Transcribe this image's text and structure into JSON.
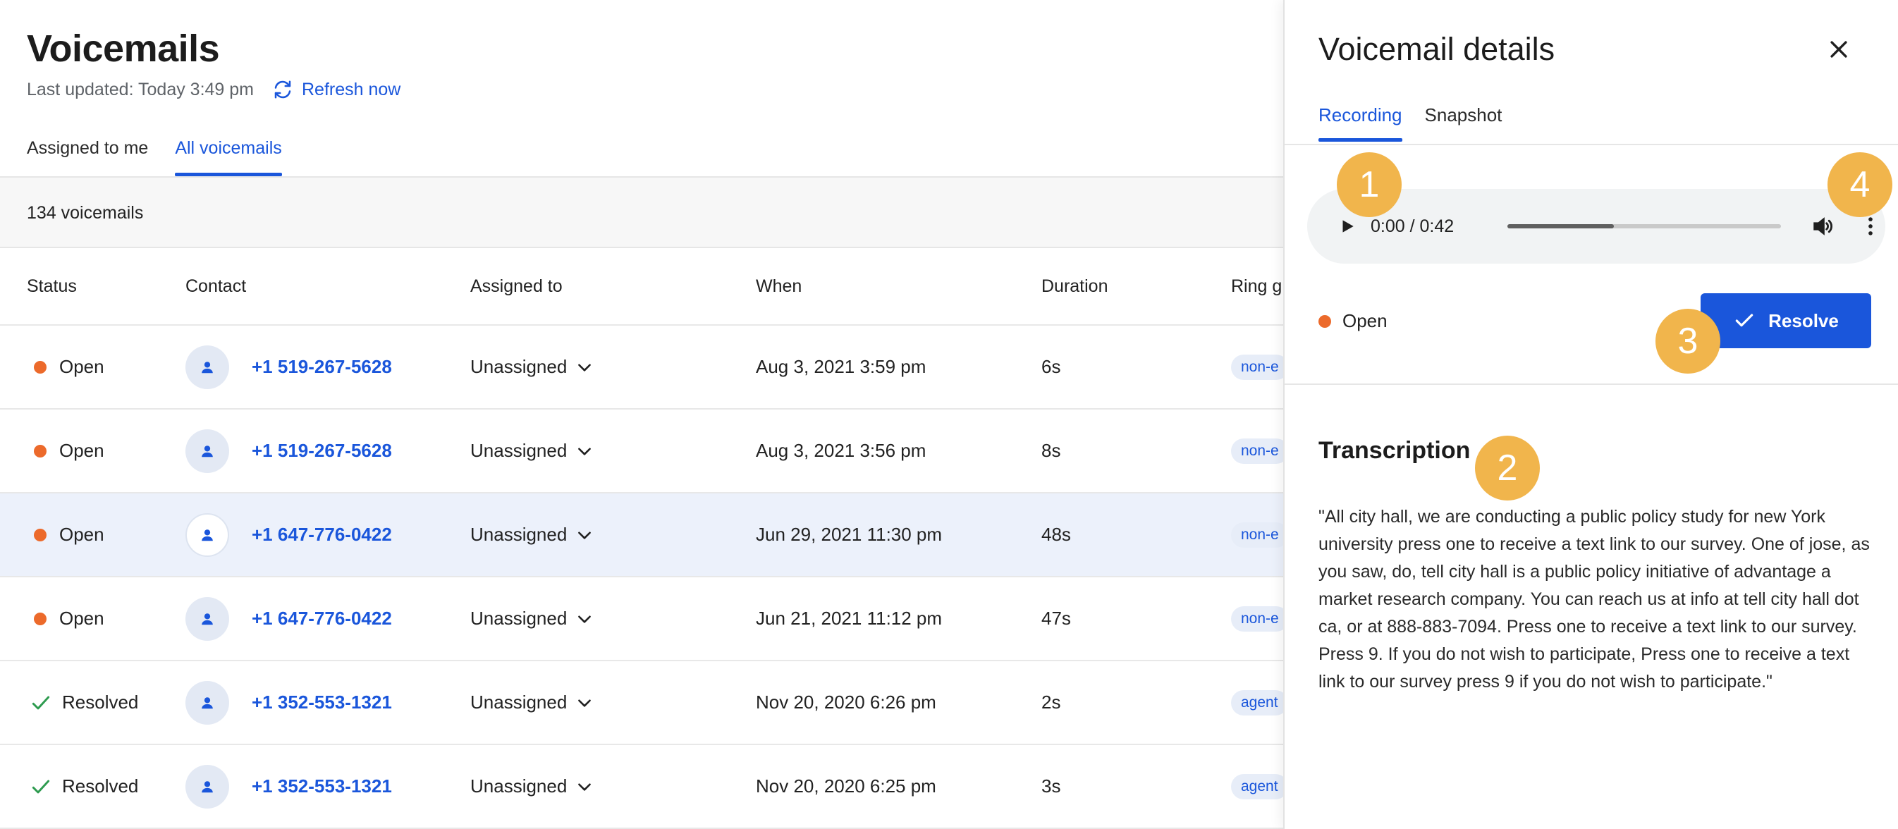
{
  "header": {
    "title": "Voicemails",
    "last_updated": "Last updated: Today 3:49 pm",
    "refresh_label": "Refresh now"
  },
  "tabs": [
    {
      "label": "Assigned to me",
      "active": false
    },
    {
      "label": "All voicemails",
      "active": true
    }
  ],
  "count_label": "134 voicemails",
  "table": {
    "columns": [
      "Status",
      "Contact",
      "Assigned to",
      "When",
      "Duration",
      "Ring g"
    ],
    "rows": [
      {
        "status": "Open",
        "phone": "+1 519-267-5628",
        "assigned": "Unassigned",
        "when": "Aug 3, 2021 3:59 pm",
        "duration": "6s",
        "ring": "non-e"
      },
      {
        "status": "Open",
        "phone": "+1 519-267-5628",
        "assigned": "Unassigned",
        "when": "Aug 3, 2021 3:56 pm",
        "duration": "8s",
        "ring": "non-e"
      },
      {
        "status": "Open",
        "phone": "+1 647-776-0422",
        "assigned": "Unassigned",
        "when": "Jun 29, 2021 11:30 pm",
        "duration": "48s",
        "ring": "non-e",
        "selected": true
      },
      {
        "status": "Open",
        "phone": "+1 647-776-0422",
        "assigned": "Unassigned",
        "when": "Jun 21, 2021 11:12 pm",
        "duration": "47s",
        "ring": "non-e"
      },
      {
        "status": "Resolved",
        "phone": "+1 352-553-1321",
        "assigned": "Unassigned",
        "when": "Nov 20, 2020 6:26 pm",
        "duration": "2s",
        "ring": "agent"
      },
      {
        "status": "Resolved",
        "phone": "+1 352-553-1321",
        "assigned": "Unassigned",
        "when": "Nov 20, 2020 6:25 pm",
        "duration": "3s",
        "ring": "agent"
      }
    ]
  },
  "panel": {
    "title": "Voicemail details",
    "tabs": [
      {
        "label": "Recording",
        "active": true
      },
      {
        "label": "Snapshot",
        "active": false
      }
    ],
    "player": {
      "time": "0:00 / 0:42",
      "progress": 0.39
    },
    "status": "Open",
    "resolve_label": "Resolve",
    "transcription_title": "Transcription",
    "transcription": "\"All city hall, we are conducting a public policy study for new York university press one to receive a text link to our survey. One of jose, as you saw, do, tell city hall is a public policy initiative of advantage a market research company. You can reach us at info at tell city hall dot ca, or at 888-883-7094. Press one to receive a text link to our survey. Press 9. If you do not wish to participate, Press one to receive a text link to our survey press 9 if you do not wish to participate.\""
  },
  "callouts": [
    "1",
    "2",
    "3",
    "4"
  ],
  "colors": {
    "accent": "#1a56db",
    "open_status": "#ec6a2b",
    "resolved_status": "#2e9b4f",
    "callout": "#f1b54c"
  }
}
